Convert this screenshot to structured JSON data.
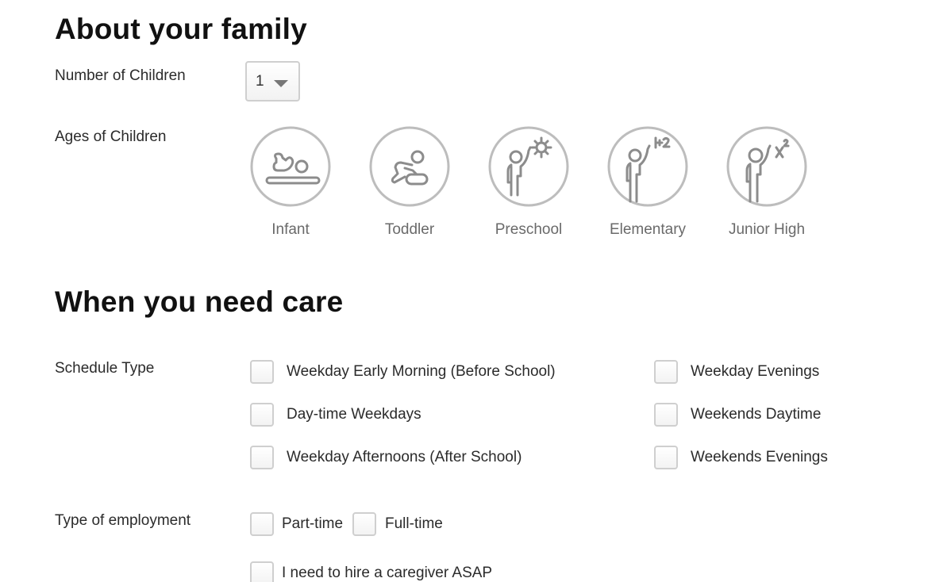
{
  "family": {
    "title": "About your family",
    "children_count_label": "Number of Children",
    "children_count_value": "1",
    "ages_label": "Ages of Children",
    "ages": [
      {
        "label": "Infant",
        "icon": "infant-icon",
        "selected": false
      },
      {
        "label": "Toddler",
        "icon": "toddler-icon",
        "selected": false
      },
      {
        "label": "Preschool",
        "icon": "preschool-icon",
        "selected": false
      },
      {
        "label": "Elementary",
        "icon": "elementary-icon",
        "selected": false
      },
      {
        "label": "Junior High",
        "icon": "junior-high-icon",
        "selected": false
      }
    ],
    "icon_color": "#8c8c8c",
    "circle_color": "#bdbdbd"
  },
  "care": {
    "title": "When you need care",
    "schedule_label": "Schedule Type",
    "schedule_options": [
      {
        "label": "Weekday Early Morning (Before School)",
        "checked": false
      },
      {
        "label": "Day-time Weekdays",
        "checked": false
      },
      {
        "label": "Weekday Afternoons (After School)",
        "checked": false
      },
      {
        "label": "Weekday Evenings",
        "checked": false
      },
      {
        "label": "Weekends Daytime",
        "checked": false
      },
      {
        "label": "Weekends Evenings",
        "checked": false
      }
    ],
    "employment_label": "Type of employment",
    "employment_options": [
      {
        "label": "Part-time",
        "checked": false
      },
      {
        "label": "Full-time",
        "checked": false
      }
    ],
    "asap_label": "I need to hire a caregiver ASAP",
    "asap_checked": false
  }
}
